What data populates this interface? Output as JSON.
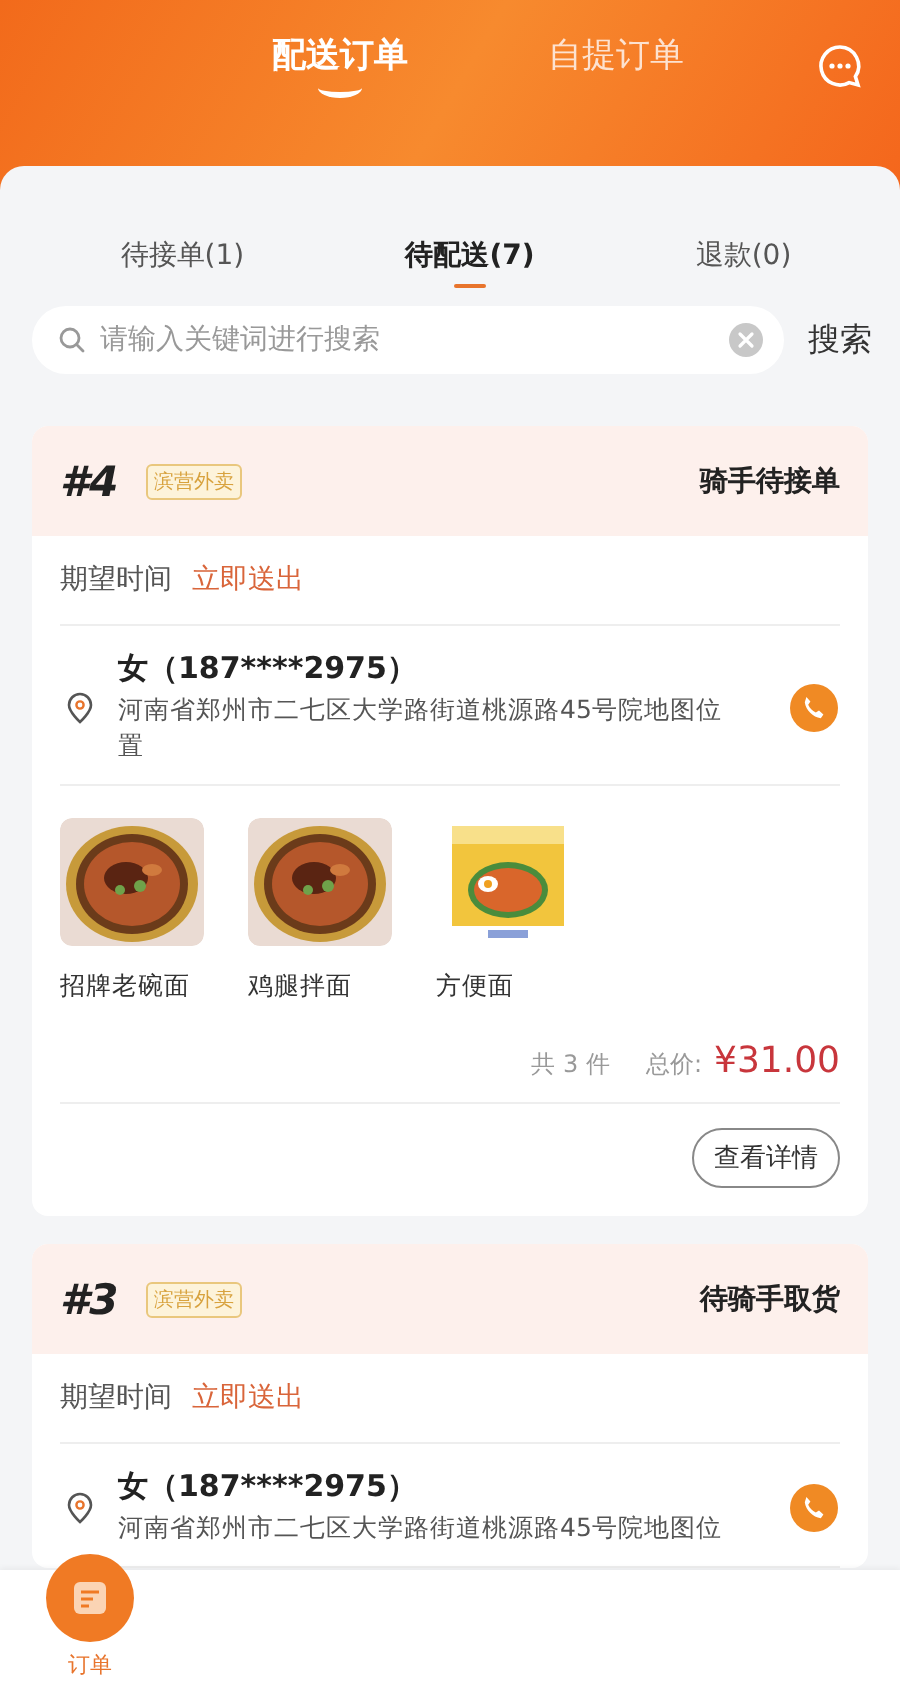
{
  "header": {
    "tabs": [
      {
        "label": "配送订单",
        "selected": true
      },
      {
        "label": "自提订单",
        "selected": false
      }
    ]
  },
  "sub_tabs": [
    {
      "label": "待接单(1)",
      "selected": false
    },
    {
      "label": "待配送(7)",
      "selected": true
    },
    {
      "label": "退款(0)",
      "selected": false
    }
  ],
  "search": {
    "placeholder": "请输入关键词进行搜索",
    "button": "搜索"
  },
  "orders": [
    {
      "number": "#4",
      "tag": "滨营外卖",
      "status": "骑手待接单",
      "expected_label": "期望时间",
      "expected_value": "立即送出",
      "customer": "女（187****2975）",
      "address": "河南省郑州市二七区大学路街道桃源路45号院地图位置",
      "items": [
        {
          "name": "招牌老碗面"
        },
        {
          "name": "鸡腿拌面"
        },
        {
          "name": "方便面"
        }
      ],
      "count": "共 3 件",
      "total_label": "总价:",
      "total": "¥31.00",
      "button": "查看详情"
    },
    {
      "number": "#3",
      "tag": "滨营外卖",
      "status": "待骑手取货",
      "expected_label": "期望时间",
      "expected_value": "立即送出",
      "customer": "女（187****2975）",
      "address": "河南省郑州市二七区大学路街道桃源路45号院地图位"
    }
  ],
  "bottom_nav": [
    {
      "label": "订单",
      "selected": true
    }
  ]
}
